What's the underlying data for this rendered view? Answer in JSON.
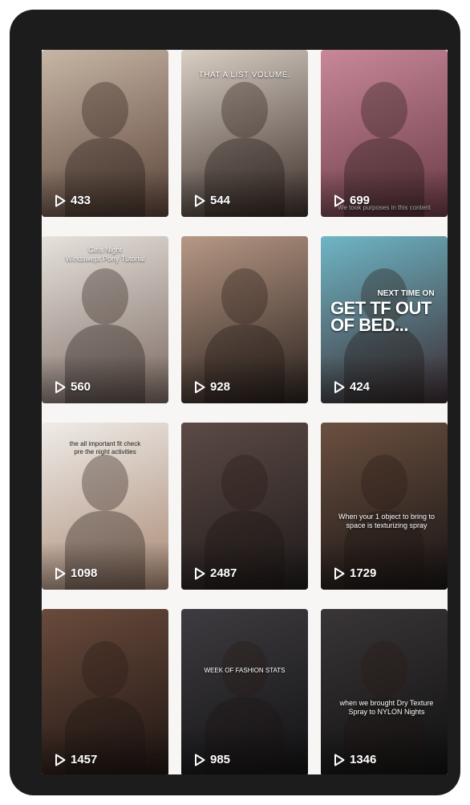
{
  "grid": {
    "tiles": [
      {
        "views": "433",
        "caption": "",
        "colors": [
          "#c7b6a6",
          "#5b4338"
        ]
      },
      {
        "views": "544",
        "caption": "THAT A LIST VOLUME.",
        "colors": [
          "#d9cfc4",
          "#3c2f2a"
        ]
      },
      {
        "views": "699",
        "caption": "We took purposes in this content",
        "colors": [
          "#c8889a",
          "#6a3a44"
        ]
      },
      {
        "views": "560",
        "caption": "Girls Night\nWindswept Pony Tutorial",
        "colors": [
          "#e7e2dc",
          "#7b6a62"
        ]
      },
      {
        "views": "928",
        "caption": "",
        "colors": [
          "#b79885",
          "#2a211d"
        ]
      },
      {
        "views": "424",
        "caption": "NEXT TIME ON",
        "headline": "GET TF OUT OF BED...",
        "colors": [
          "#6fb6c6",
          "#3b2a2f"
        ]
      },
      {
        "views": "1098",
        "caption": "the all important fit check pre the night activities",
        "colors": [
          "#efece8",
          "#a98974"
        ]
      },
      {
        "views": "2487",
        "caption": "",
        "colors": [
          "#5c4a45",
          "#1f1b1b"
        ]
      },
      {
        "views": "1729",
        "caption": "When your 1 object to bring to space is texturizing spray",
        "colors": [
          "#6b5040",
          "#181414"
        ]
      },
      {
        "views": "1457",
        "caption": "",
        "colors": [
          "#6a4b3c",
          "#1e1512"
        ]
      },
      {
        "views": "985",
        "caption": "WEEK OF FASHION STATS",
        "colors": [
          "#3e3c40",
          "#121113"
        ]
      },
      {
        "views": "1346",
        "caption": "when we brought Dry Texture Spray to NYLON Nights",
        "colors": [
          "#3a3638",
          "#101010"
        ]
      }
    ]
  }
}
